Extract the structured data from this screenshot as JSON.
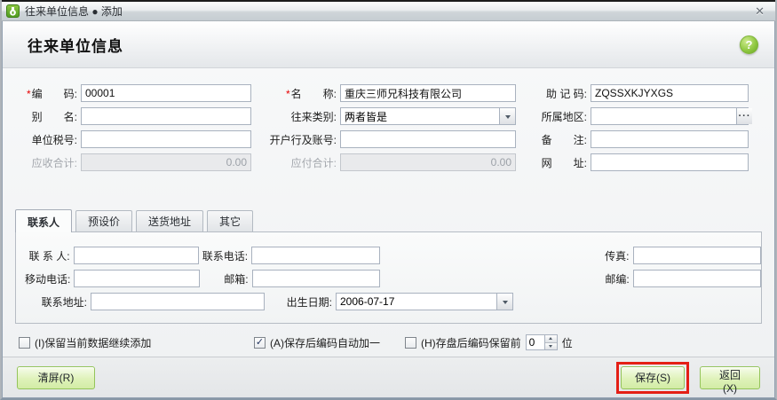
{
  "titlebar": {
    "title": "往来单位信息 ● 添加",
    "close": "✕"
  },
  "header": {
    "title": "往来单位信息",
    "help": "?"
  },
  "colors": {
    "accent_green": "#8cc63e",
    "annotation_red": "#e41f15",
    "required_red": "#e60000"
  },
  "form": {
    "code": {
      "req": "*",
      "label": "编　　码:",
      "value": "00001"
    },
    "name": {
      "req": "*",
      "label": "名　　称:",
      "value": "重庆三师兄科技有限公司"
    },
    "mnemonic": {
      "label": "助 记 码:",
      "value": "ZQSSXKJYXGS"
    },
    "alias": {
      "label": "别　　名:",
      "value": ""
    },
    "category": {
      "label": "往来类别:",
      "value": "两者皆是"
    },
    "region": {
      "label": "所属地区:",
      "value": "",
      "browse": "···"
    },
    "tax": {
      "label": "单位税号:",
      "value": ""
    },
    "bank": {
      "label": "开户行及账号:",
      "value": ""
    },
    "remark": {
      "label": "备　　注:",
      "value": ""
    },
    "receivable": {
      "label": "应收合计:",
      "value": "0.00"
    },
    "payable": {
      "label": "应付合计:",
      "value": "0.00"
    },
    "website": {
      "label": "网　　址:",
      "value": ""
    }
  },
  "tabs": {
    "contact": "联系人",
    "preset_price": "预设价",
    "delivery_address": "送货地址",
    "other": "其它",
    "active": "联系人"
  },
  "contact": {
    "person": {
      "label": "联 系 人:",
      "value": ""
    },
    "phone": {
      "label": "联系电话:",
      "value": ""
    },
    "fax": {
      "label": "传真:",
      "value": ""
    },
    "mobile": {
      "label": "移动电话:",
      "value": ""
    },
    "email": {
      "label": "邮箱:",
      "value": ""
    },
    "zip": {
      "label": "邮编:",
      "value": ""
    },
    "address": {
      "label": "联系地址:",
      "value": ""
    },
    "birth": {
      "label": "出生日期:",
      "value": "2006-07-17"
    }
  },
  "options": {
    "keep_data": {
      "label": "(I)保留当前数据继续添加",
      "checked": false,
      "mark": ""
    },
    "auto_increment": {
      "label": "(A)保存后编码自动加一",
      "checked": true,
      "mark": "✓"
    },
    "keep_prefix": {
      "label": "(H)存盘后编码保留前",
      "checked": false,
      "mark": "",
      "value": "0",
      "suffix": "位"
    }
  },
  "footer": {
    "clear": "清屏(R)",
    "save": "保存(S)",
    "back": "返回(X)"
  }
}
